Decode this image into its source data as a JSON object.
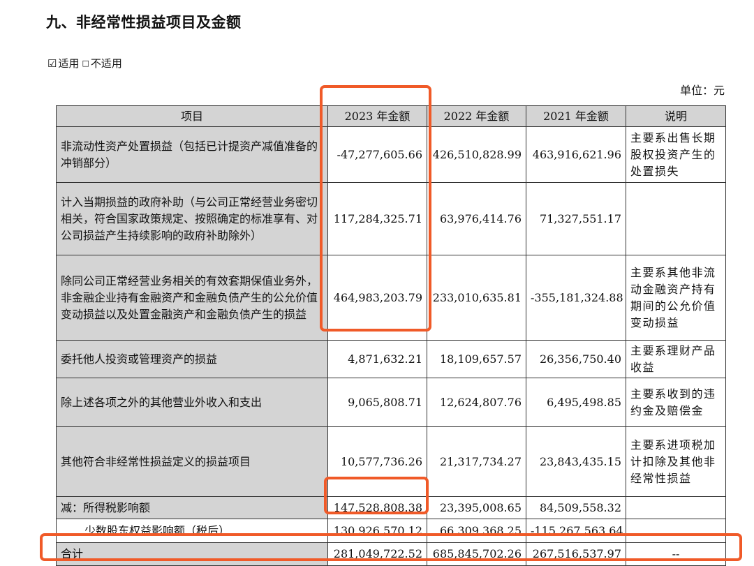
{
  "title": "九、非经常性损益项目及金额",
  "applicability": {
    "checked_symbol": "☑",
    "checked_label": "适用",
    "unchecked_symbol": "□",
    "unchecked_label": "不适用"
  },
  "unit": "单位：元",
  "headers": [
    "项目",
    "2023 年金额",
    "2022 年金额",
    "2021 年金额",
    "说明"
  ],
  "rows": [
    {
      "item": "非流动性资产处置损益（包括已计提资产减值准备的冲销部分）",
      "y2023": "-47,277,605.66",
      "y2022": "426,510,828.99",
      "y2021": "463,916,621.96",
      "note": "主要系出售长期股权投资产生的处置损失"
    },
    {
      "item": "计入当期损益的政府补助（与公司正常经营业务密切相关，符合国家政策规定、按照确定的标准享有、对公司损益产生持续影响的政府补助除外）",
      "y2023": "117,284,325.71",
      "y2022": "63,976,414.76",
      "y2021": "71,327,551.17",
      "note": ""
    },
    {
      "item": "除同公司正常经营业务相关的有效套期保值业务外，非金融企业持有金融资产和金融负债产生的公允价值变动损益以及处置金融资产和金融负债产生的损益",
      "y2023": "464,983,203.79",
      "y2022": "233,010,635.81",
      "y2021": "-355,181,324.88",
      "note": "主要系其他非流动金融资产持有期间的公允价值变动损益"
    },
    {
      "item": "委托他人投资或管理资产的损益",
      "y2023": "4,871,632.21",
      "y2022": "18,109,657.57",
      "y2021": "26,356,750.40",
      "note": "主要系理财产品收益"
    },
    {
      "item": "除上述各项之外的其他营业外收入和支出",
      "y2023": "9,065,808.71",
      "y2022": "12,624,807.76",
      "y2021": "6,495,498.85",
      "note": "主要系收到的违约金及赔偿金"
    },
    {
      "item": "其他符合非经常性损益定义的损益项目",
      "y2023": "10,577,736.26",
      "y2022": "21,317,734.27",
      "y2021": "23,843,435.15",
      "note": "主要系进项税加计扣除及其他非经常性损益"
    },
    {
      "item": "减：所得税影响额",
      "y2023": "147,528,808.38",
      "y2022": "23,395,008.65",
      "y2021": "84,509,558.32",
      "note": ""
    },
    {
      "item": "少数股东权益影响额（税后）",
      "y2023": "130,926,570.12",
      "y2022": "66,309,368.25",
      "y2021": "-115,267,563.64",
      "note": ""
    },
    {
      "item": "合计",
      "y2023": "281,049,722.52",
      "y2022": "685,845,702.26",
      "y2021": "267,516,537.97",
      "note": "--"
    }
  ],
  "highlight_color": "#f05a28"
}
